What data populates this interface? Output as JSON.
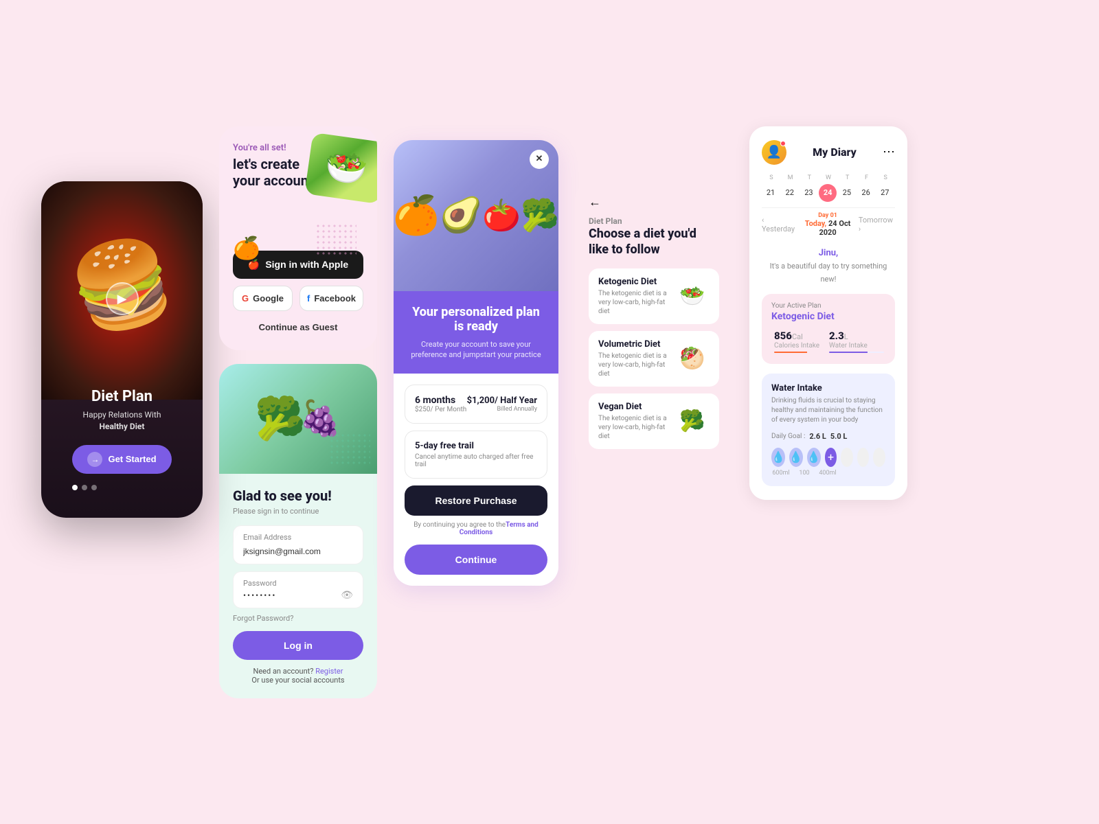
{
  "phone1": {
    "title": "Diet Plan",
    "subtitle": "Happy Relations With\nHealthy Diet",
    "get_started": "Get Started"
  },
  "create_account": {
    "youre_all_set": "You're all set!",
    "heading1": "let's create",
    "heading2": "your account",
    "sign_apple": "Sign in with Apple",
    "google": "Google",
    "facebook": "Facebook",
    "guest": "Continue as Guest"
  },
  "login": {
    "title": "Glad to see you!",
    "subtitle": "Please sign in to continue",
    "email_label": "Email Address",
    "email_value": "jksignsin@gmail.com",
    "password_label": "Password",
    "password_value": "••••••••",
    "forgot": "Forgot Password?",
    "login_btn": "Log in",
    "no_account": "Need an account?",
    "register": "Register",
    "social": "Or use your social accounts"
  },
  "pricing": {
    "title": "Your personalized plan is ready",
    "subtitle": "Create your account to save your preference and jumpstart your practice",
    "plan1_name": "6 months",
    "plan1_price_small": "$250/ Per Month",
    "plan1_price": "$1,200/ Half Year",
    "plan1_billing": "Billed Annually",
    "plan2_name": "5-day free trail",
    "plan2_desc": "Cancel anytime auto charged after free trail",
    "restore": "Restore Purchase",
    "terms1": "By continuing you agree to the",
    "terms2": "Terms and Conditions",
    "continue": "Continue"
  },
  "diet_choose": {
    "section": "Diet Plan",
    "title": "Choose a diet you'd like to follow",
    "items": [
      {
        "name": "Ketogenic Diet",
        "desc": "The ketogenic diet is a very low-carb, high-fat diet",
        "emoji": "🥗"
      },
      {
        "name": "Volumetric Diet",
        "desc": "The ketogenic diet is a very low-carb, high-fat diet",
        "emoji": "🥙"
      },
      {
        "name": "Vegan Diet",
        "desc": "The ketogenic diet is a very low-carb, high-fat diet",
        "emoji": "🥦"
      }
    ]
  },
  "diary": {
    "title": "My Diary",
    "user_emoji": "👤",
    "week": [
      {
        "day": "S",
        "num": "21"
      },
      {
        "day": "M",
        "num": "22"
      },
      {
        "day": "T",
        "num": "23"
      },
      {
        "day": "W",
        "num": "24",
        "active": true
      },
      {
        "day": "T",
        "num": "25"
      },
      {
        "day": "F",
        "num": "26"
      },
      {
        "day": "S",
        "num": "27"
      }
    ],
    "day_label": "Day 01",
    "yesterday": "Yesterday",
    "today": "Today,  24 Oct 2020",
    "tomorrow": "Tomorrow",
    "greeting_name": "Jinu,",
    "greeting_msg": "It's a beautiful day to try something new!",
    "active_plan_label": "Your Active Plan",
    "active_plan_name": "Ketogenic Diet",
    "cal_val": "856",
    "cal_unit": "Cal",
    "cal_label": "Calories Intake",
    "water_val": "2.3",
    "water_unit": "L",
    "water_label": "Water Intake",
    "water_card_title": "Water Intake",
    "water_card_desc": "Drinking fluids is crucial to staying healthy and maintaining the function of every system in your body",
    "daily_goal_label": "Daily Goal :",
    "daily_goal_val1": "2.6 L",
    "daily_goal_val2": "5.0 L",
    "glasses": [
      "💧",
      "💧",
      "💧",
      "",
      "",
      ""
    ]
  }
}
